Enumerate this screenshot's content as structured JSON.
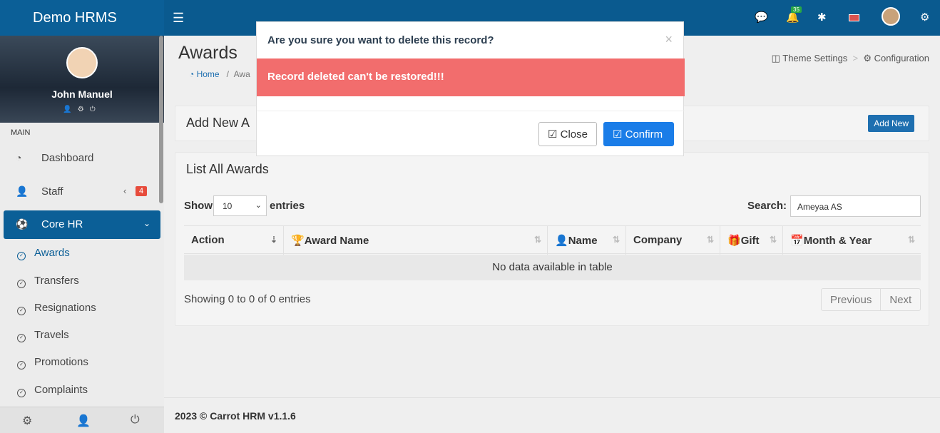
{
  "topbar": {
    "brand": "Demo HRMS",
    "notifications_count": "35",
    "icons": [
      "menu-icon",
      "chat-icon",
      "bell-icon",
      "asterisk-icon",
      "flag-icon",
      "avatar",
      "gear-icon"
    ]
  },
  "sidebar": {
    "user_name": "John Manuel",
    "section_label": "MAIN",
    "items": [
      {
        "label": "Dashboard",
        "icon": "dashboard-icon"
      },
      {
        "label": "Staff",
        "icon": "user-icon",
        "badge": "4"
      },
      {
        "label": "Core HR",
        "icon": "futbol-icon"
      }
    ],
    "sub_items": [
      {
        "label": "Awards"
      },
      {
        "label": "Transfers"
      },
      {
        "label": "Resignations"
      },
      {
        "label": "Travels"
      },
      {
        "label": "Promotions"
      },
      {
        "label": "Complaints"
      }
    ]
  },
  "page": {
    "title": "Awards",
    "breadcrumb_home": "Home",
    "breadcrumb_current": "Awa",
    "theme_settings": "Theme Settings",
    "configuration": "Configuration"
  },
  "add_card": {
    "title": "Add New A",
    "add_button": "Add New"
  },
  "list_card": {
    "title": "List All Awards",
    "show_label": "Show",
    "entries_label": "entries",
    "page_size": "10",
    "search_label": "Search:",
    "search_value": "Ameyaa AS",
    "columns": [
      "Action",
      "Award Name",
      "Name",
      "Company",
      "Gift",
      "Month & Year"
    ],
    "empty_text": "No data available in table",
    "showing_text": "Showing 0 to 0 of 0 entries",
    "prev_label": "Previous",
    "next_label": "Next"
  },
  "footer": {
    "text": "2023 © Carrot HRM v1.1.6"
  },
  "modal": {
    "title": "Are you sure you want to delete this record?",
    "close_symbol": "×",
    "alert_text": "Record deleted can't be restored!!!",
    "close_label": "Close",
    "confirm_label": "Confirm",
    "alert_color": "#f26d6d",
    "confirm_color": "#1a7de8"
  }
}
